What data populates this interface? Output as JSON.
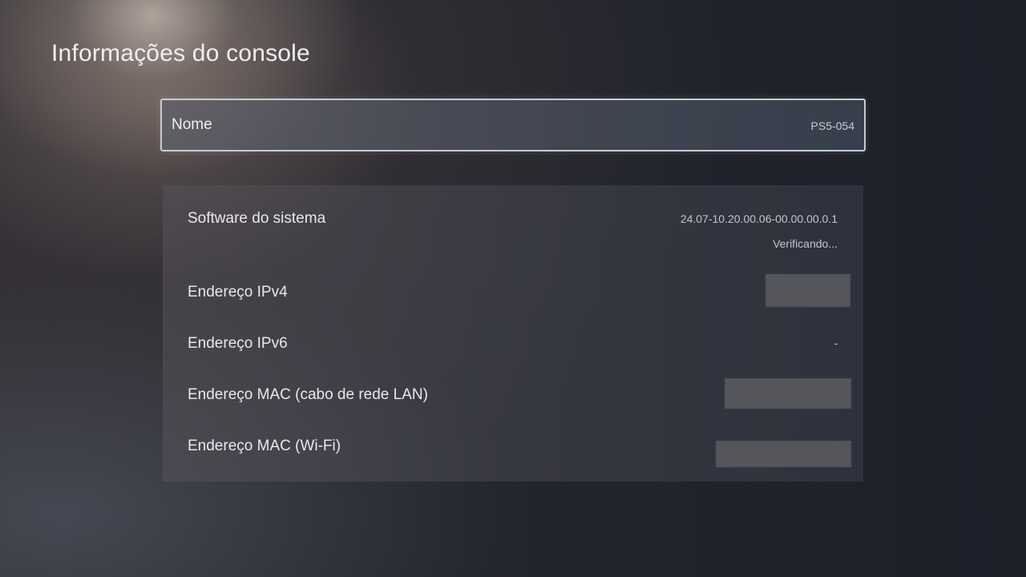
{
  "page": {
    "title": "Informações do console"
  },
  "name_row": {
    "label": "Nome",
    "value": "PS5-054"
  },
  "info": {
    "system_software": {
      "label": "Software do sistema",
      "value": "24.07-10.20.00.06-00.00.00.0.1",
      "status": "Verificando..."
    },
    "ipv4": {
      "label": "Endereço IPv4",
      "value_redacted": true
    },
    "ipv6": {
      "label": "Endereço IPv6",
      "value": "-"
    },
    "mac_lan": {
      "label": "Endereço MAC (cabo de rede LAN)",
      "value_redacted": true
    },
    "mac_wifi": {
      "label": "Endereço MAC (Wi-Fi)",
      "value_redacted": true
    }
  }
}
